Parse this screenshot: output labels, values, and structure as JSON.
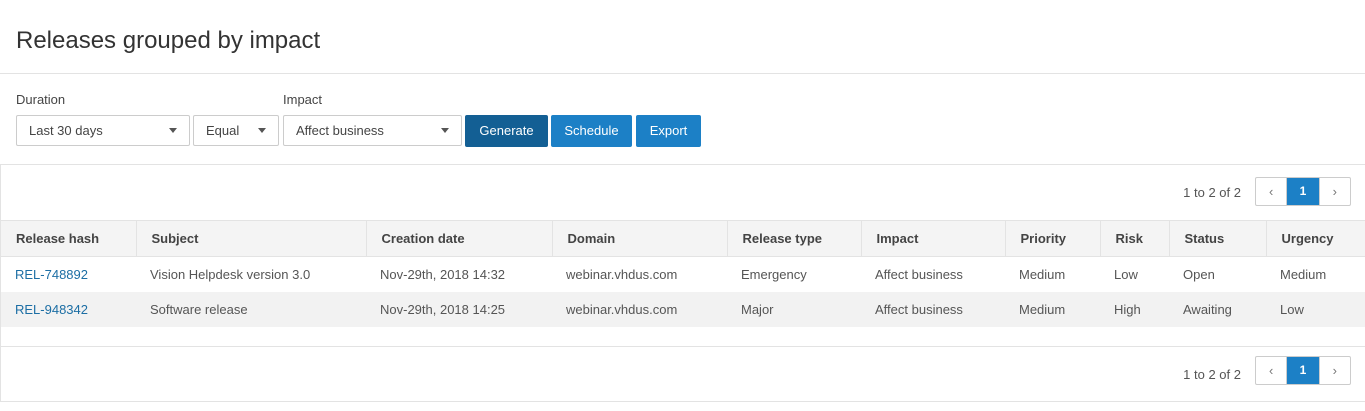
{
  "page": {
    "title": "Releases grouped by impact"
  },
  "filters": {
    "duration_label": "Duration",
    "duration_value": "Last 30 days",
    "operator_value": "Equal",
    "impact_label": "Impact",
    "impact_value": "Affect business"
  },
  "actions": {
    "generate_label": "Generate",
    "schedule_label": "Schedule",
    "export_label": "Export"
  },
  "pagination": {
    "summary": "1 to 2 of 2",
    "prev": "‹",
    "current_page": "1",
    "next": "›"
  },
  "table": {
    "headers": [
      "Release hash",
      "Subject",
      "Creation date",
      "Domain",
      "Release type",
      "Impact",
      "Priority",
      "Risk",
      "Status",
      "Urgency"
    ],
    "rows": [
      [
        "REL-748892",
        "Vision Helpdesk version 3.0",
        "Nov-29th, 2018 14:32",
        "webinar.vhdus.com",
        "Emergency",
        "Affect business",
        "Medium",
        "Low",
        "Open",
        "Medium"
      ],
      [
        "REL-948342",
        "Software release",
        "Nov-29th, 2018 14:25",
        "webinar.vhdus.com",
        "Major",
        "Affect business",
        "Medium",
        "High",
        "Awaiting",
        "Low"
      ]
    ]
  },
  "colors": {
    "accent": "#1c80c6",
    "accent_dark": "#135f94",
    "link": "#1c6ea4"
  }
}
